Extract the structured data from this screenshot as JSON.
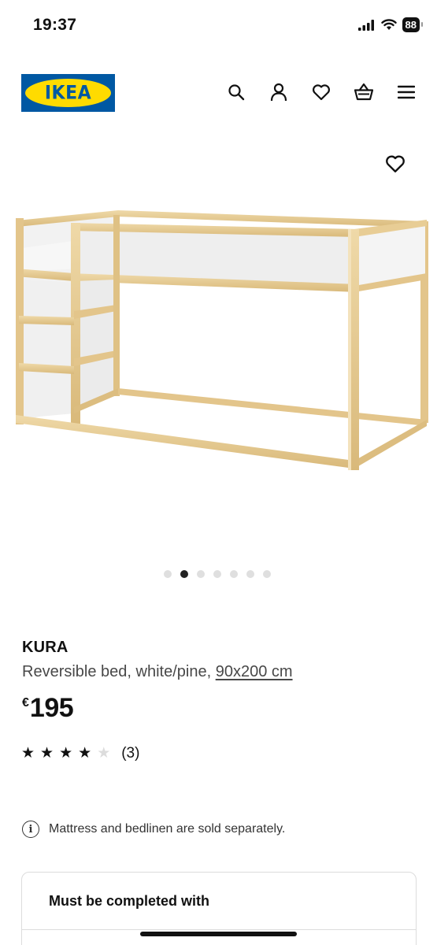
{
  "status_bar": {
    "time": "19:37",
    "battery": "88"
  },
  "header": {
    "logo_text": "IKEA",
    "brand_colors": {
      "blue": "#0058a3",
      "yellow": "#ffdb00"
    },
    "icons": [
      "search-icon",
      "account-icon",
      "heart-icon",
      "basket-icon",
      "menu-icon"
    ]
  },
  "carousel": {
    "total": 7,
    "active_index": 1
  },
  "product": {
    "name": "KURA",
    "description": "Reversible bed, white/pine, ",
    "size_link": "90x200 cm",
    "price_currency": "€",
    "price_amount": "195",
    "rating": {
      "stars_filled": 4,
      "stars_total": 5,
      "review_count": "(3)"
    }
  },
  "info_note": "Mattress and bedlinen are sold separately.",
  "completion_card": {
    "title": "Must be completed with"
  }
}
